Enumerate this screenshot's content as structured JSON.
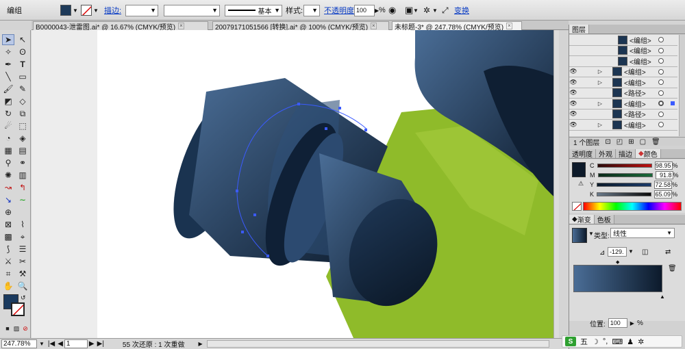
{
  "control_bar": {
    "mode_label": "编组",
    "stroke_label": "描边:",
    "line_style": "基本",
    "style_label": "样式:",
    "opacity_label": "不透明度:",
    "opacity_value": "100",
    "opacity_unit": "%",
    "transform_label": "变换",
    "fill_color": "#1e3a5a"
  },
  "tabs": [
    {
      "label": "B0000043-泄雷图.ai* @ 16.67% (CMYK/预览)"
    },
    {
      "label": "20079171051566 [转换].ai* @ 100% (CMYK/预览)"
    },
    {
      "label": "未标题-3* @ 247.78% (CMYK/预览)",
      "active": true
    }
  ],
  "status": {
    "zoom": "247.78%",
    "page": "1",
    "history": "55 次还原 : 1 次重做"
  },
  "layers_panel": {
    "title": "图层",
    "rows": [
      {
        "label": "<编组>",
        "visible": false
      },
      {
        "label": "<编组>",
        "visible": false
      },
      {
        "label": "<编组>",
        "visible": false
      },
      {
        "label": "<编组>",
        "visible": true
      },
      {
        "label": "<编组>",
        "visible": true
      },
      {
        "label": "<路径>",
        "visible": true
      },
      {
        "label": "<编组>",
        "visible": true,
        "selected": true
      },
      {
        "label": "<路径>",
        "visible": true
      },
      {
        "label": "<编组>",
        "visible": true
      }
    ],
    "footer": "1 个图层"
  },
  "color_panel": {
    "tabs": [
      "透明度",
      "外观",
      "描边",
      "颜色"
    ],
    "sliders": [
      {
        "label": "C",
        "value": "98.95",
        "unit": "%"
      },
      {
        "label": "M",
        "value": "91.8",
        "unit": "%"
      },
      {
        "label": "Y",
        "value": "72.58",
        "unit": "%"
      },
      {
        "label": "K",
        "value": "65.09",
        "unit": "%"
      }
    ],
    "swatch_color": "#0d1a2a"
  },
  "gradient_panel": {
    "tabs": [
      "渐变",
      "色板"
    ],
    "type_label": "类型:",
    "type_value": "线性",
    "angle_value": "-129.",
    "location_label": "位置:",
    "location_value": "100",
    "location_unit": "%",
    "start_color": "#4a6d96",
    "end_color": "#0c1a2b"
  },
  "ime_bar": {
    "items": [
      "五"
    ]
  }
}
